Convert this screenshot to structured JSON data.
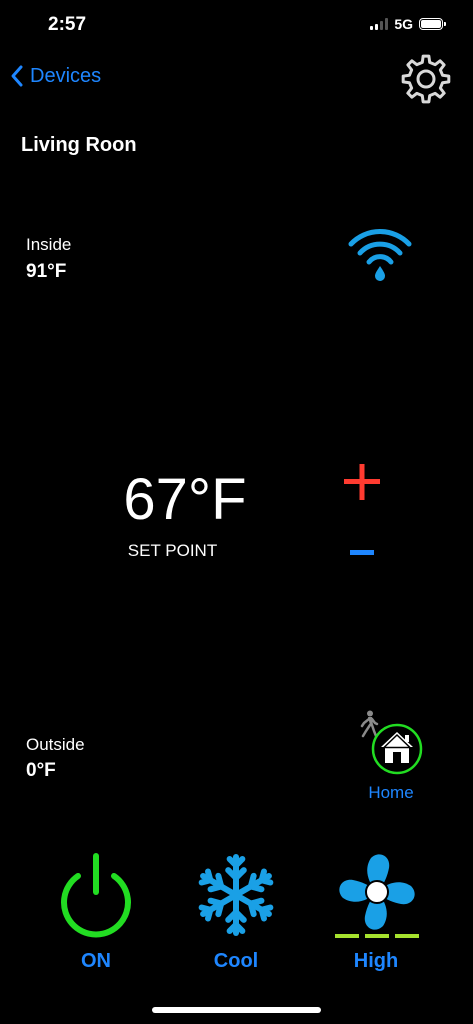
{
  "status_bar": {
    "time": "2:57",
    "network": "5G"
  },
  "nav": {
    "back_label": "Devices",
    "back_icon": "chevron-left-icon",
    "settings_icon": "gear-icon"
  },
  "room": {
    "name": "Living Roon"
  },
  "inside": {
    "label": "Inside",
    "value": "91°F"
  },
  "setpoint": {
    "value": "67°F",
    "label": "SET POINT"
  },
  "outside": {
    "label": "Outside",
    "value": "0°F"
  },
  "occupancy": {
    "label": "Home",
    "icon": "house-icon"
  },
  "controls": {
    "power_label": "ON",
    "mode_label": "Cool",
    "fan_label": "High"
  },
  "colors": {
    "accent_blue": "#1e86ff",
    "wifi_blue": "#1aa0e6",
    "plus_red": "#ff3b30",
    "power_green": "#22dd22",
    "fan_level_green": "#a6e22e"
  }
}
